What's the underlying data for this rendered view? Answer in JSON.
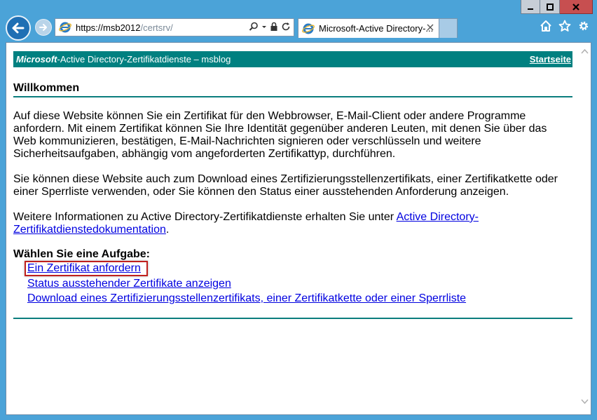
{
  "browser": {
    "url_host": "https://msb2012",
    "url_path": "/certsrv/",
    "tab_title": "Microsoft-Active Directory-..."
  },
  "page": {
    "header_brand": "Microsoft",
    "header_title": "-Active Directory-Zertifikatdienste  –  msblog",
    "home_link": "Startseite",
    "welcome": "Willkommen",
    "paragraph1": "Auf diese Website können Sie ein Zertifikat für den Webbrowser, E-Mail-Client oder andere Programme anfordern. Mit einem Zertifikat können Sie Ihre Identität gegenüber anderen Leuten, mit denen Sie über das Web kommunizieren, bestätigen, E-Mail-Nachrichten signieren oder verschlüsseln und weitere Sicherheitsaufgaben, abhängig vom angeforderten Zertifikattyp, durchführen.",
    "paragraph2": "Sie können diese Website auch zum Download eines Zertifizierungsstellenzertifikats, einer Zertifikatkette oder einer Sperrliste verwenden, oder Sie können den Status einer ausstehenden Anforderung anzeigen.",
    "paragraph3_prefix": "Weitere Informationen zu Active Directory-Zertifikatdienste erhalten Sie unter ",
    "paragraph3_link": "Active Directory-Zertifikatdienstedokumentation",
    "paragraph3_suffix": ".",
    "task_heading": "Wählen Sie eine Aufgabe:",
    "tasks": [
      "Ein Zertifikat anfordern",
      "Status ausstehender Zertifikate anzeigen",
      "Download eines Zertifizierungsstellenzertifikats, einer Zertifikatkette oder einer Sperrliste"
    ]
  },
  "colors": {
    "teal": "#008080",
    "link": "#0000e0",
    "highlight": "#c0201e"
  }
}
